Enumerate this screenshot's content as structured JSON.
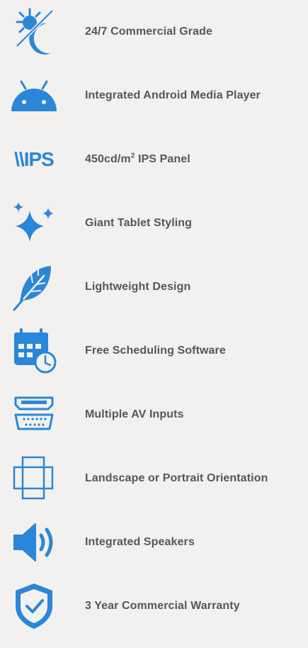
{
  "accent_color": "#2a86d8",
  "features": [
    {
      "icon": "sun-moon-icon",
      "label": "24/7 Commercial Grade"
    },
    {
      "icon": "android-icon",
      "label": "Integrated Android Media Player"
    },
    {
      "icon": "ips-icon",
      "icon_text": "\\\\IPS",
      "label_main": "450cd/m",
      "label_sup": "2",
      "label_rest": " IPS Panel"
    },
    {
      "icon": "sparkles-icon",
      "label": "Giant Tablet Styling"
    },
    {
      "icon": "feather-icon",
      "label": "Lightweight Design"
    },
    {
      "icon": "calendar-clock-icon",
      "label": "Free Scheduling Software"
    },
    {
      "icon": "hdmi-vga-icon",
      "label": "Multiple AV Inputs"
    },
    {
      "icon": "rotate-frames-icon",
      "label": "Landscape or Portrait Orientation"
    },
    {
      "icon": "speaker-icon",
      "label": "Integrated Speakers"
    },
    {
      "icon": "shield-check-icon",
      "label": "3 Year Commercial Warranty"
    }
  ]
}
